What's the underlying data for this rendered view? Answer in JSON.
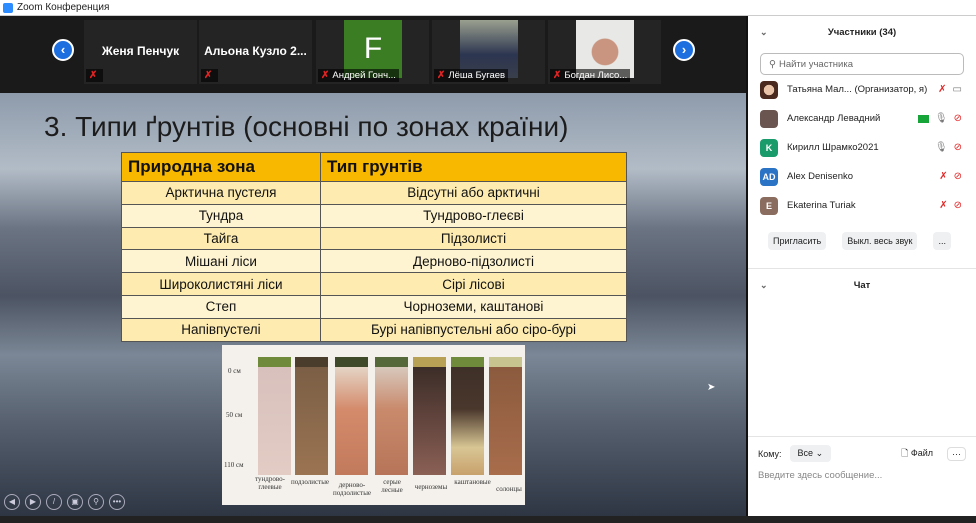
{
  "window": {
    "title": "Zoom Конференция"
  },
  "gallery": {
    "tiles": [
      {
        "name": "Женя Пенчук",
        "label": ""
      },
      {
        "name": "Альона Кузло 2...",
        "label": ""
      },
      {
        "name": "",
        "initial": "F",
        "label": "Андрей Гонч..."
      },
      {
        "name": "",
        "label": "Лёша Бугаев"
      },
      {
        "name": "",
        "label": "Богдан Лисо..."
      }
    ],
    "prev": "‹",
    "next": "›"
  },
  "slide": {
    "title": "3. Типи ґрунтів (основні по зонах країни)",
    "table": {
      "headers": [
        "Природна зона",
        "Тип грунтів"
      ],
      "rows": [
        [
          "Арктична пустеля",
          "Відсутні або арктичні"
        ],
        [
          "Тундра",
          "Тундрово-глеєві"
        ],
        [
          "Тайга",
          "Підзолисті"
        ],
        [
          "Мішані ліси",
          "Дерново-підзолисті"
        ],
        [
          "Широколистяні ліси",
          "Сірі лісові"
        ],
        [
          "Степ",
          "Чорноземи, каштанові"
        ],
        [
          "Напівпустелі",
          "Бурі напівпустельні або сіро-бурі"
        ]
      ]
    },
    "image": {
      "depths": [
        "0 см",
        "50 см",
        "110 см"
      ],
      "soils": [
        "тундрово-глеевые",
        "подзолистые",
        "дерново-подзолистые",
        "серые лесные",
        "черноземы",
        "каштановые",
        "солонцы"
      ]
    }
  },
  "panel": {
    "participants_title": "Участники (34)",
    "search_placeholder": "Найти участника",
    "participants": [
      {
        "initials": "",
        "name": "Татьяна Мал...  (Организатор, я)",
        "color": "#7a4b3a"
      },
      {
        "initials": "",
        "name": "Александр Левадний",
        "color": "#6a5550"
      },
      {
        "initials": "K",
        "name": "Кирилл Шрамко2021",
        "color": "#1a9b6c"
      },
      {
        "initials": "AD",
        "name": "Alex Denisenko",
        "color": "#2b73c4"
      },
      {
        "initials": "E",
        "name": "Ekaterina Turiak",
        "color": "#8a6d5e"
      }
    ],
    "invite": "Пригласить",
    "mute_all": "Выкл. весь звук",
    "more": "...",
    "chat_title": "Чат",
    "to_label": "Кому:",
    "to_value": "Все",
    "file": "Файл",
    "message_placeholder": "Введите здесь сообщение..."
  }
}
